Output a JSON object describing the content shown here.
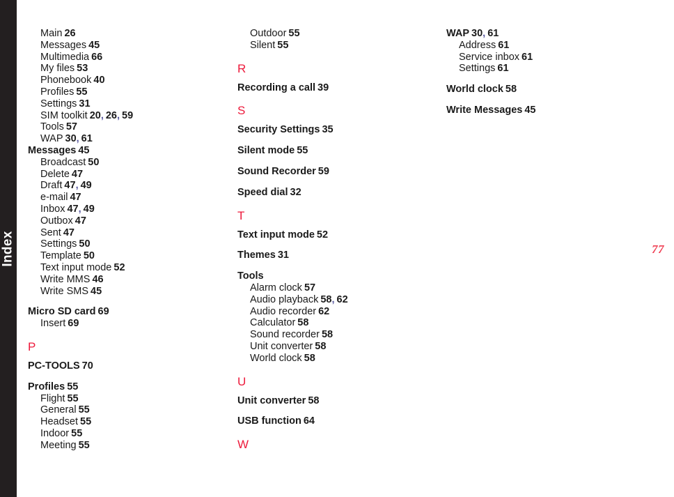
{
  "document": {
    "tab_label": "Index",
    "page_number": "77",
    "accent_color": "#ed1a3b",
    "page_number_color": "#ef3e52",
    "tab_background_color": "#231f20",
    "text_color": "#1a1a1a",
    "separator_color": "#5a5aa0"
  },
  "columns": [
    {
      "id": "column-1",
      "blocks": [
        {
          "type": "entries",
          "gap_before": false,
          "entries": [
            {
              "level": "sub",
              "label": "Main",
              "pages": [
                "26"
              ]
            },
            {
              "level": "sub",
              "label": "Messages",
              "pages": [
                "45"
              ]
            },
            {
              "level": "sub",
              "label": "Multimedia",
              "pages": [
                "66"
              ]
            },
            {
              "level": "sub",
              "label": "My files",
              "pages": [
                "53"
              ]
            },
            {
              "level": "sub",
              "label": "Phonebook",
              "pages": [
                "40"
              ]
            },
            {
              "level": "sub",
              "label": "Profiles",
              "pages": [
                "55"
              ]
            },
            {
              "level": "sub",
              "label": "Settings",
              "pages": [
                "31"
              ]
            },
            {
              "level": "sub",
              "label": "SIM toolkit",
              "pages": [
                "20",
                "26",
                "59"
              ]
            },
            {
              "level": "sub",
              "label": "Tools",
              "pages": [
                "57"
              ]
            },
            {
              "level": "sub",
              "label": "WAP",
              "pages": [
                "30",
                "61"
              ]
            }
          ]
        },
        {
          "type": "entries",
          "gap_before": false,
          "entries": [
            {
              "level": "main",
              "label": "Messages",
              "pages": [
                "45"
              ]
            },
            {
              "level": "sub",
              "label": "Broadcast",
              "pages": [
                "50"
              ]
            },
            {
              "level": "sub",
              "label": "Delete",
              "pages": [
                "47"
              ]
            },
            {
              "level": "sub",
              "label": "Draft",
              "pages": [
                "47",
                "49"
              ]
            },
            {
              "level": "sub",
              "label": "e-mail",
              "pages": [
                "47"
              ]
            },
            {
              "level": "sub",
              "label": "Inbox",
              "pages": [
                "47",
                "49"
              ]
            },
            {
              "level": "sub",
              "label": "Outbox",
              "pages": [
                "47"
              ]
            },
            {
              "level": "sub",
              "label": "Sent",
              "pages": [
                "47"
              ]
            },
            {
              "level": "sub",
              "label": "Settings",
              "pages": [
                "50"
              ]
            },
            {
              "level": "sub",
              "label": "Template",
              "pages": [
                "50"
              ]
            },
            {
              "level": "sub",
              "label": "Text input mode",
              "pages": [
                "52"
              ]
            },
            {
              "level": "sub",
              "label": "Write MMS",
              "pages": [
                "46"
              ]
            },
            {
              "level": "sub",
              "label": "Write SMS",
              "pages": [
                "45"
              ]
            },
            {
              "level": "main",
              "label": "Micro SD card",
              "pages": [
                "69"
              ]
            },
            {
              "level": "sub",
              "label": "Insert",
              "pages": [
                "69"
              ]
            }
          ]
        },
        {
          "type": "letter",
          "gap_before": true,
          "letter": "P"
        },
        {
          "type": "entries",
          "gap_before": false,
          "entries": [
            {
              "level": "main",
              "label": "PC-TOOLS",
              "pages": [
                "70"
              ]
            },
            {
              "level": "main",
              "label": "Profiles",
              "pages": [
                "55"
              ]
            },
            {
              "level": "sub",
              "label": "Flight",
              "pages": [
                "55"
              ]
            },
            {
              "level": "sub",
              "label": "General",
              "pages": [
                "55"
              ]
            },
            {
              "level": "sub",
              "label": "Headset",
              "pages": [
                "55"
              ]
            },
            {
              "level": "sub",
              "label": "Indoor",
              "pages": [
                "55"
              ]
            },
            {
              "level": "sub",
              "label": "Meeting",
              "pages": [
                "55"
              ]
            }
          ]
        }
      ]
    },
    {
      "id": "column-2",
      "blocks": [
        {
          "type": "entries",
          "gap_before": false,
          "entries": [
            {
              "level": "sub",
              "label": "Outdoor",
              "pages": [
                "55"
              ]
            },
            {
              "level": "sub",
              "label": "Silent",
              "pages": [
                "55"
              ]
            }
          ]
        },
        {
          "type": "letter",
          "gap_before": true,
          "letter": "R"
        },
        {
          "type": "entries",
          "gap_before": false,
          "entries": [
            {
              "level": "main",
              "label": "Recording a call",
              "pages": [
                "39"
              ]
            }
          ]
        },
        {
          "type": "letter",
          "gap_before": true,
          "letter": "S"
        },
        {
          "type": "entries",
          "gap_before": false,
          "entries": [
            {
              "level": "main",
              "label": "Security Settings",
              "pages": [
                "35"
              ]
            },
            {
              "level": "main",
              "label": "Silent mode",
              "pages": [
                "55"
              ]
            },
            {
              "level": "main",
              "label": "Sound Recorder",
              "pages": [
                "59"
              ]
            },
            {
              "level": "main",
              "label": "Speed dial",
              "pages": [
                "32"
              ]
            }
          ]
        },
        {
          "type": "letter",
          "gap_before": true,
          "letter": "T"
        },
        {
          "type": "entries",
          "gap_before": false,
          "entries": [
            {
              "level": "main",
              "label": "Text input mode",
              "pages": [
                "52"
              ]
            },
            {
              "level": "main",
              "label": "Themes",
              "pages": [
                "31"
              ]
            },
            {
              "level": "main",
              "label": "Tools",
              "pages": []
            },
            {
              "level": "sub",
              "label": "Alarm clock",
              "pages": [
                "57"
              ]
            },
            {
              "level": "sub",
              "label": "Audio playback",
              "pages": [
                "58",
                "62"
              ]
            },
            {
              "level": "sub",
              "label": "Audio recorder",
              "pages": [
                "62"
              ]
            },
            {
              "level": "sub",
              "label": "Calculator",
              "pages": [
                "58"
              ]
            },
            {
              "level": "sub",
              "label": "Sound recorder",
              "pages": [
                "58"
              ]
            },
            {
              "level": "sub",
              "label": "Unit converter",
              "pages": [
                "58"
              ]
            },
            {
              "level": "sub",
              "label": "World clock",
              "pages": [
                "58"
              ]
            }
          ]
        },
        {
          "type": "letter",
          "gap_before": true,
          "letter": "U"
        },
        {
          "type": "entries",
          "gap_before": false,
          "entries": [
            {
              "level": "main",
              "label": "Unit converter",
              "pages": [
                "58"
              ]
            },
            {
              "level": "main",
              "label": "USB function",
              "pages": [
                "64"
              ]
            }
          ]
        },
        {
          "type": "letter",
          "gap_before": true,
          "letter": "W"
        }
      ]
    },
    {
      "id": "column-3",
      "blocks": [
        {
          "type": "entries",
          "gap_before": false,
          "entries": [
            {
              "level": "main",
              "label": "WAP",
              "pages": [
                "30",
                "61"
              ]
            },
            {
              "level": "sub",
              "label": "Address",
              "pages": [
                "61"
              ]
            },
            {
              "level": "sub",
              "label": "Service inbox",
              "pages": [
                "61"
              ]
            },
            {
              "level": "sub",
              "label": "Settings",
              "pages": [
                "61"
              ]
            },
            {
              "level": "main",
              "label": "World clock",
              "pages": [
                "58"
              ]
            },
            {
              "level": "main",
              "label": "Write Messages",
              "pages": [
                "45"
              ]
            }
          ]
        }
      ]
    }
  ]
}
